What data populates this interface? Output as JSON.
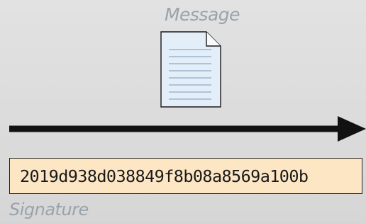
{
  "message": {
    "label": "Message",
    "icon": "document-icon"
  },
  "signature": {
    "value": "2019d938d038849f8b08a8569a100b",
    "label": "Signature",
    "box_color": "#fde6c4"
  },
  "colors": {
    "background": "#dcdcdc",
    "label_text": "#9aa3ab",
    "document_fill": "#e4eef8",
    "document_lines": "#9ab6d1",
    "arrow": "#111111"
  }
}
